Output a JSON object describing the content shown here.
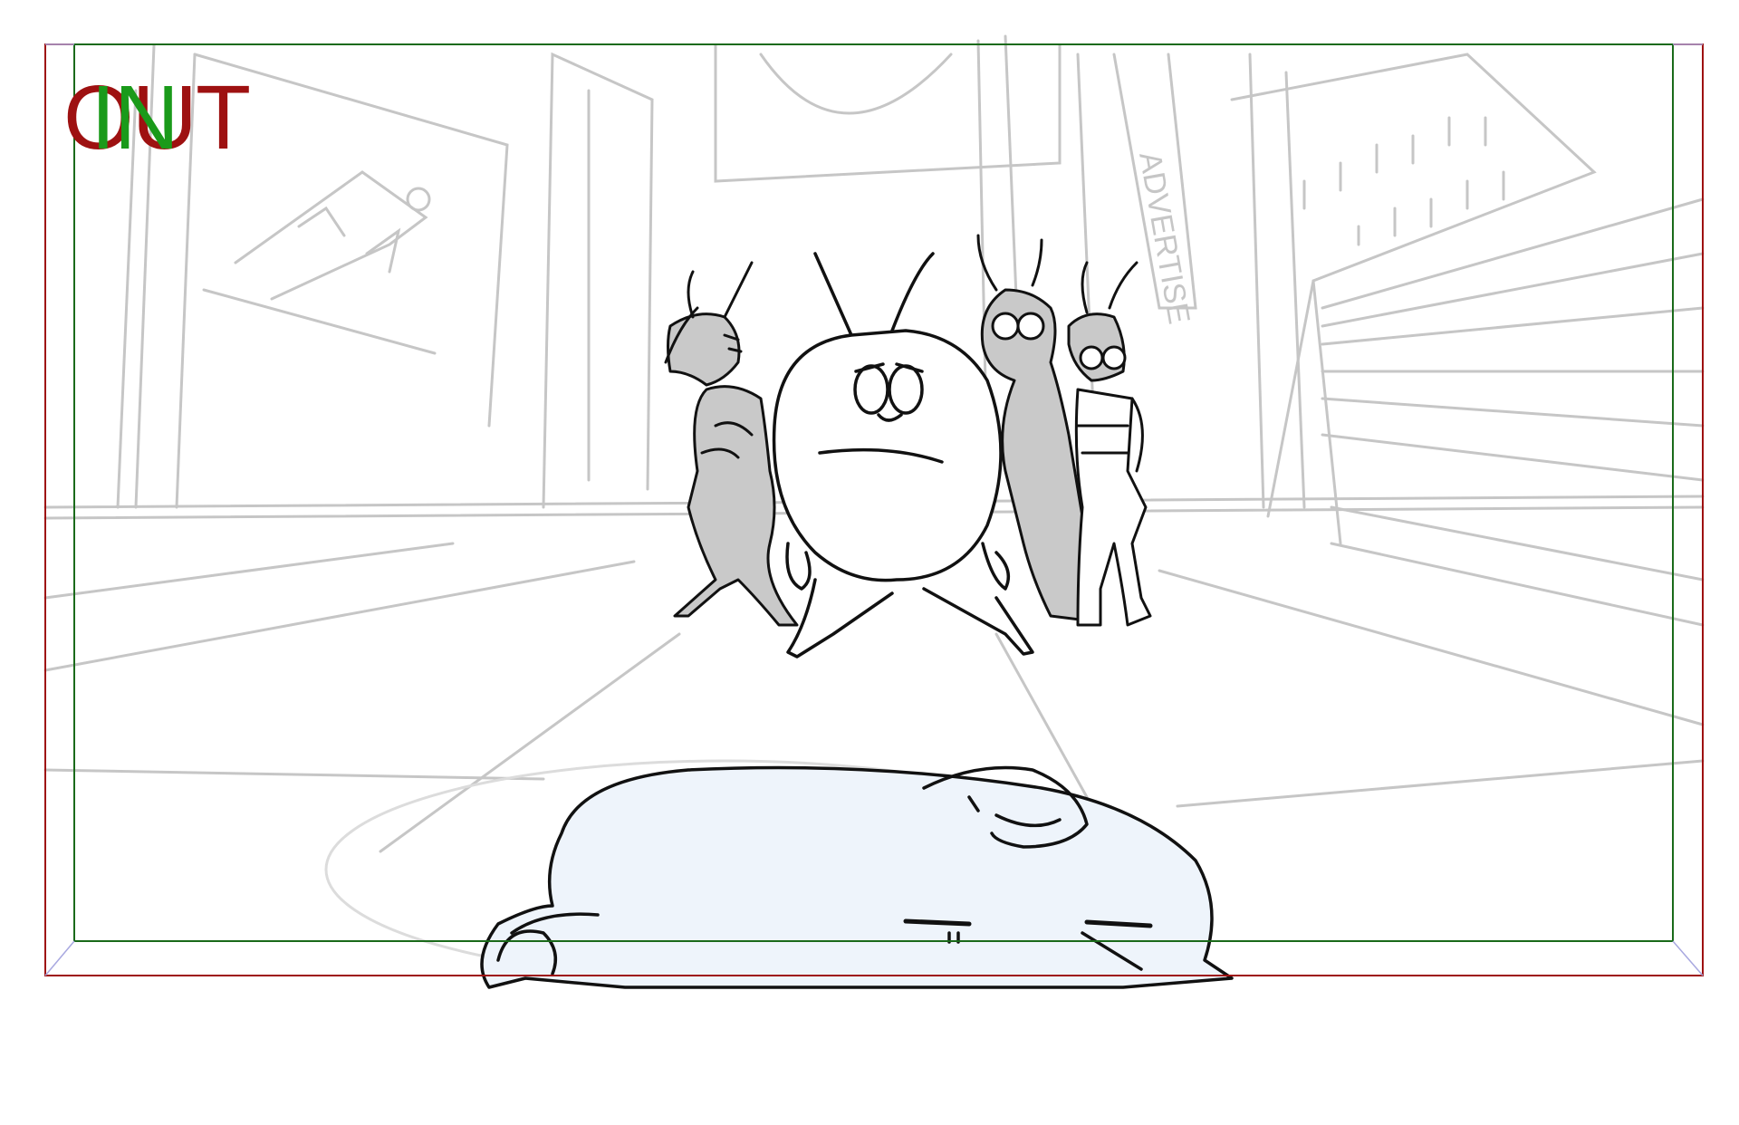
{
  "frame_labels": {
    "out": "OUT",
    "in": "IN"
  },
  "colors": {
    "out_frame": "#9e1111",
    "in_frame": "#1a6a1a",
    "bg_sketch": "#c6c6c6",
    "ink": "#111111",
    "fill_grey": "#c9c9c9",
    "blob_fill": "#eef4fb"
  },
  "sign_text": "ADVERTISE"
}
